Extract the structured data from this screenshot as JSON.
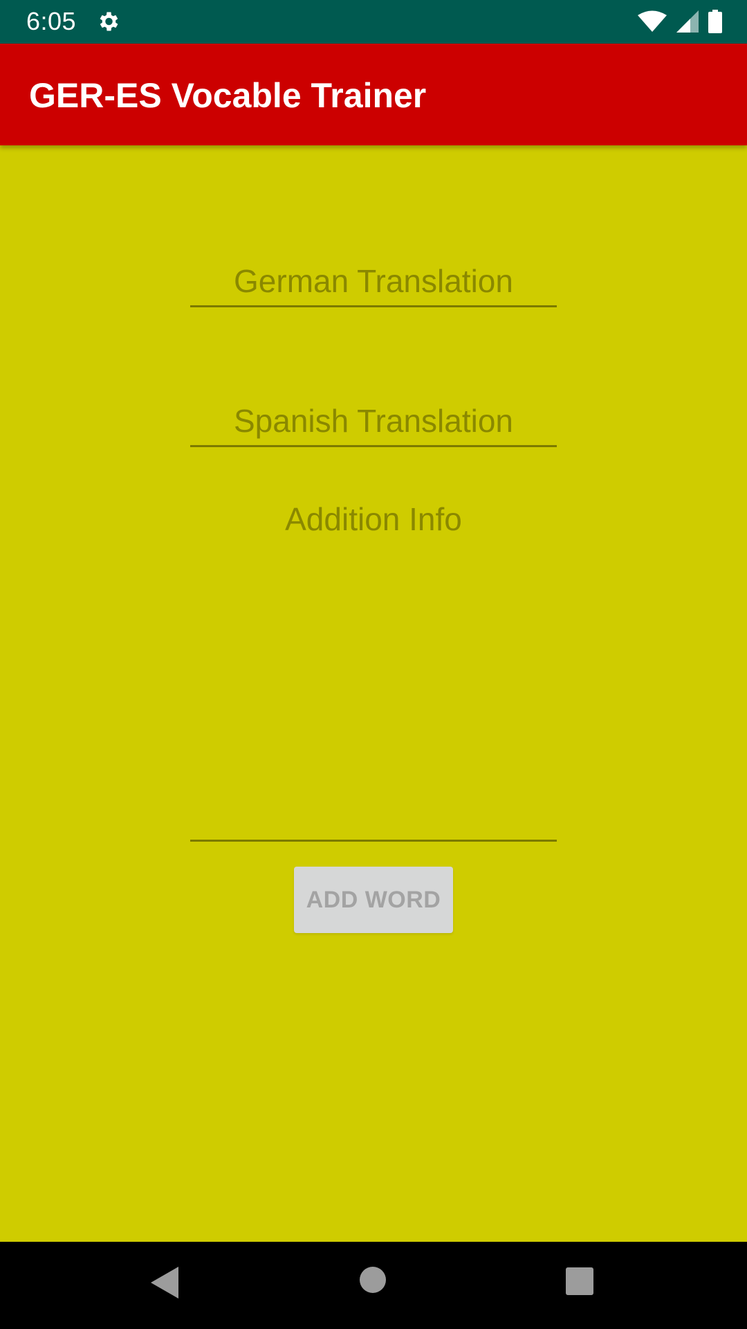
{
  "status_bar": {
    "time": "6:05",
    "icons": [
      "gear-icon",
      "wifi-icon",
      "cellular-signal-icon",
      "battery-icon"
    ],
    "background": "#005a50"
  },
  "app_bar": {
    "title": "GER-ES Vocable Trainer",
    "background": "#cc0000"
  },
  "form": {
    "german": {
      "placeholder": "German Translation",
      "value": ""
    },
    "spanish": {
      "placeholder": "Spanish Translation",
      "value": ""
    },
    "info": {
      "placeholder": "Addition Info",
      "value": ""
    },
    "add_button_label": "ADD WORD",
    "background": "#cfcc00"
  },
  "nav_bar": {
    "icons": [
      "back-icon",
      "home-icon",
      "recents-icon"
    ]
  }
}
